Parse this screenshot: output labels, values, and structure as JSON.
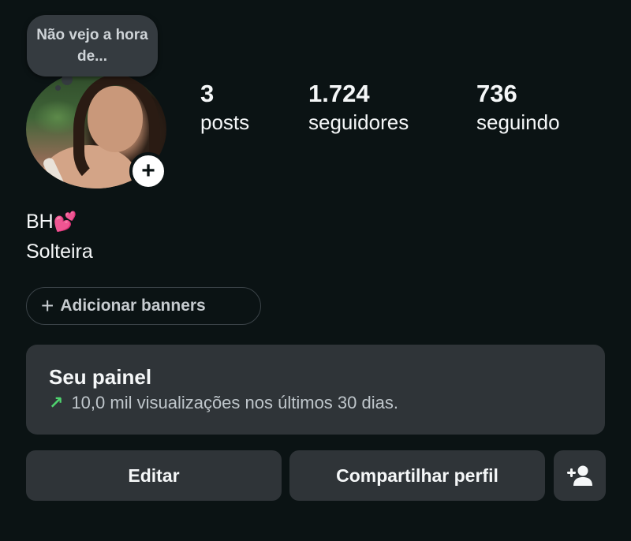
{
  "note": {
    "text": "Não vejo a hora de..."
  },
  "stats": [
    {
      "count": "3",
      "label": "posts"
    },
    {
      "count": "1.724",
      "label": "seguidores"
    },
    {
      "count": "736",
      "label": "seguindo"
    }
  ],
  "profile": {
    "name": "BH",
    "name_emoji": "💕",
    "bio": "Solteira"
  },
  "banners": {
    "plus": "+",
    "label": "Adicionar banners"
  },
  "panel": {
    "title": "Seu painel",
    "arrow": "↗",
    "subtitle": "10,0 mil visualizações nos últimos 30 dias.",
    "accent": "#4fd36e"
  },
  "buttons": {
    "edit": "Editar",
    "share": "Compartilhar perfil",
    "add_person_icon": "person-add-icon"
  },
  "add_story": {
    "icon": "plus-icon",
    "glyph": "+"
  },
  "colors": {
    "background": "#0b1314",
    "card": "#2f3438",
    "note_bubble": "#353b40"
  }
}
